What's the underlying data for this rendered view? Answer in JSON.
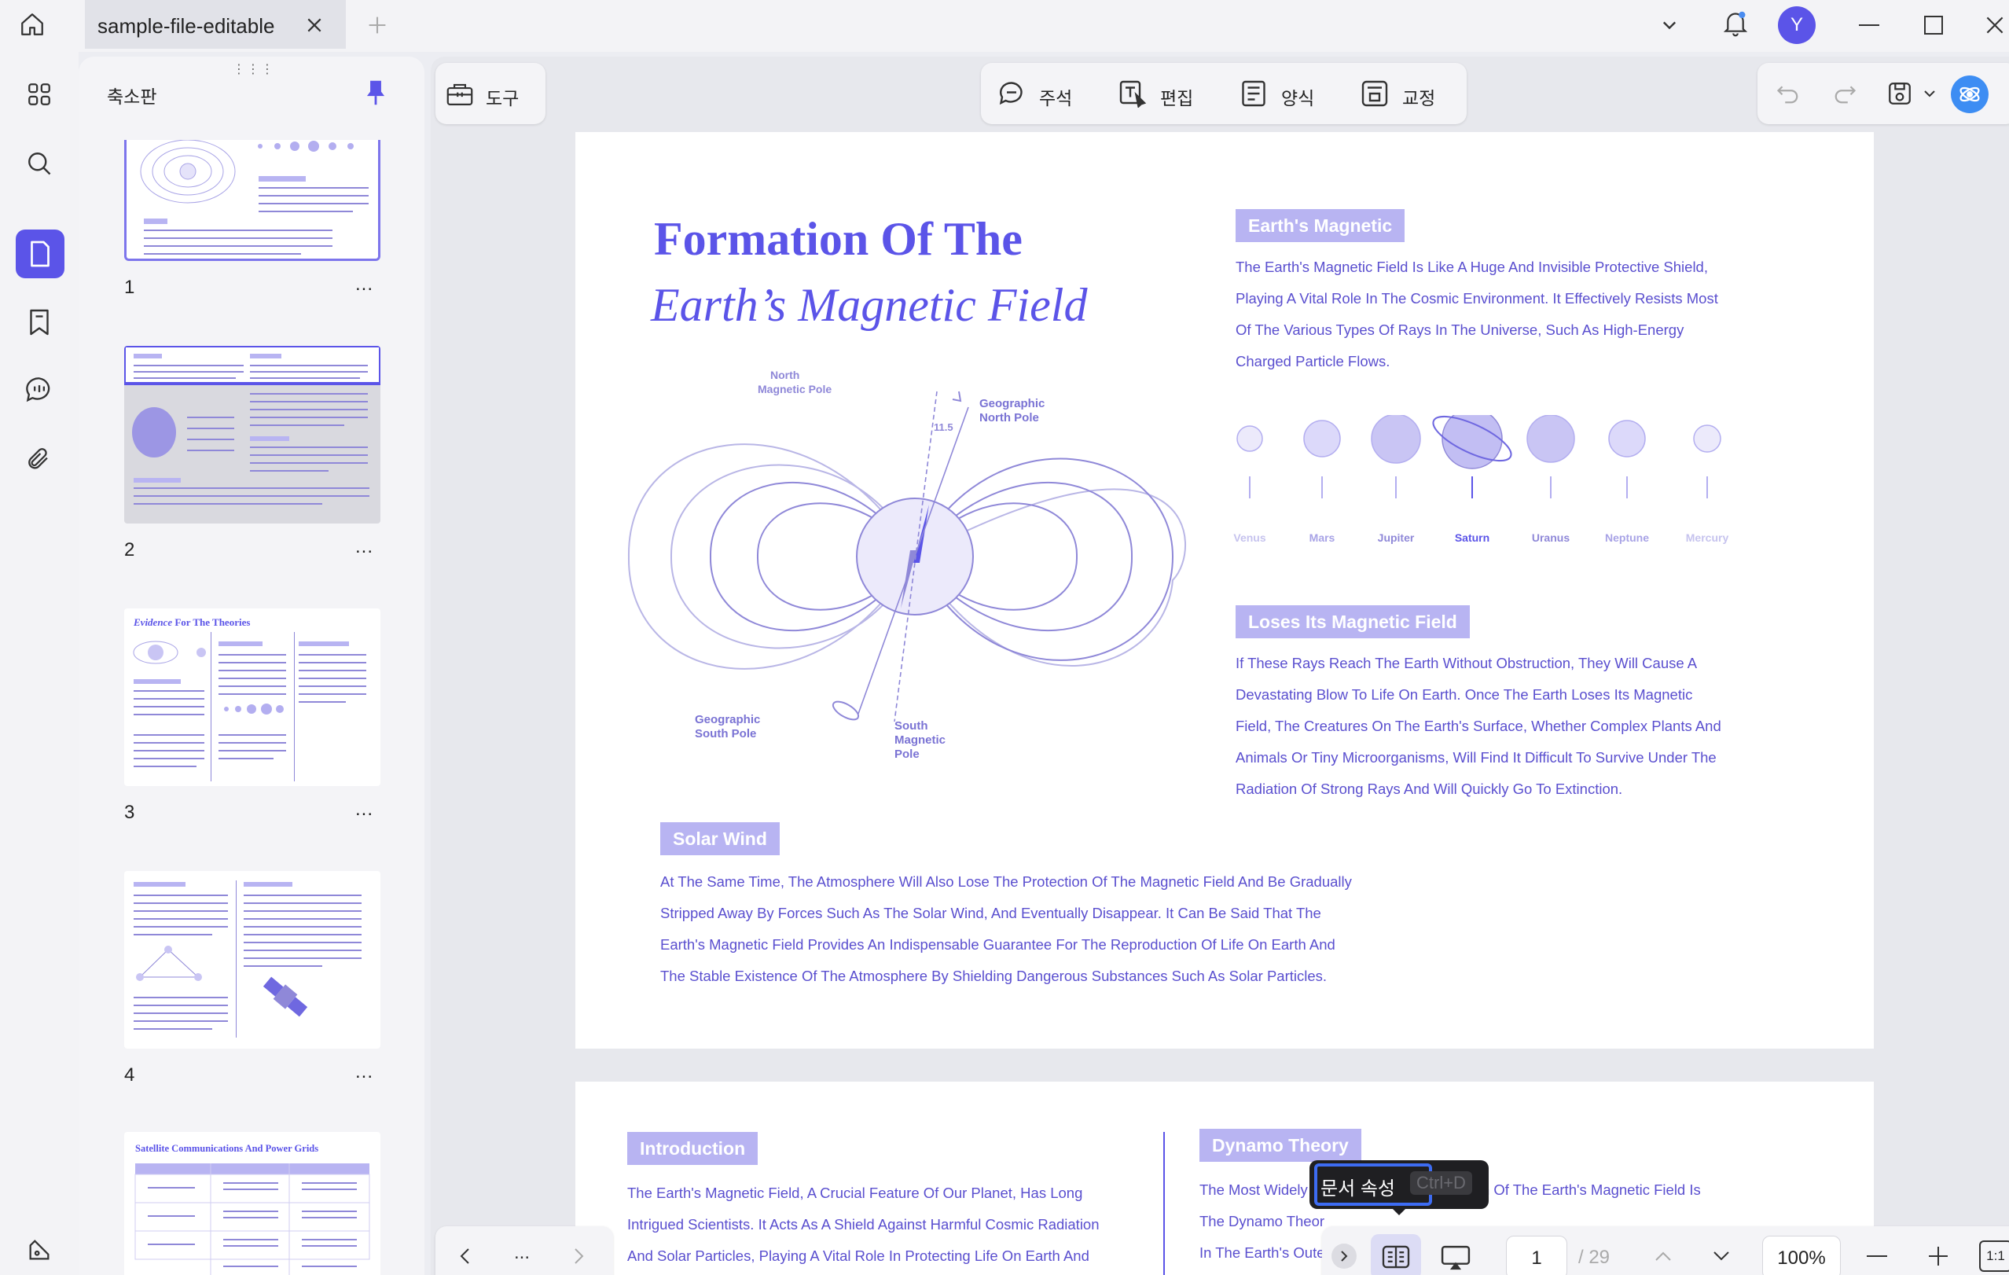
{
  "titlebar": {
    "tab_title": "sample-file-editable",
    "avatar_letter": "Y",
    "colors": {
      "accent": "#5b54e8",
      "avatar": "#5b54e8"
    }
  },
  "sidebar": {
    "panel_title": "축소판",
    "pages": [
      {
        "number": "1",
        "more": "..."
      },
      {
        "number": "2",
        "more": "..."
      },
      {
        "number": "3",
        "more": "..."
      },
      {
        "number": "4",
        "more": "..."
      }
    ],
    "thumb3_title_italic": "Evidence",
    "thumb3_title_rest": "For The Theories",
    "thumb5_title": "Satellite Communications And Power Grids"
  },
  "toolbar": {
    "tools_label": "도구",
    "annotate_label": "주석",
    "edit_label": "편집",
    "form_label": "양식",
    "proof_label": "교정"
  },
  "page1": {
    "title_line1": "Formation Of The",
    "title_line2": "Earth’s Magnetic Field",
    "diagram": {
      "north_magnetic_pole": [
        "North",
        "Magnetic Pole"
      ],
      "geographic_north_pole": [
        "Geographic",
        "North Pole"
      ],
      "angle": "11.5",
      "geographic_south_pole": [
        "Geographic",
        "South Pole"
      ],
      "south_magnetic_pole": [
        "South",
        "Magnetic",
        "Pole"
      ]
    },
    "earth_magnetic": {
      "tag": "Earth's Magnetic",
      "lines": [
        "The Earth's Magnetic Field Is Like A Huge And Invisible Protective Shield,",
        "Playing A Vital Role In The Cosmic Environment. It Effectively Resists Most",
        "Of The Various Types Of Rays In The Universe, Such As High-Energy",
        "Charged Particle Flows."
      ]
    },
    "planets": [
      "Venus",
      "Mars",
      "Jupiter",
      "Saturn",
      "Uranus",
      "Neptune",
      "Mercury"
    ],
    "loses": {
      "tag": "Loses Its Magnetic Field",
      "lines": [
        "If These Rays Reach The Earth Without Obstruction, They Will Cause A",
        "Devastating Blow To Life On Earth. Once The Earth Loses Its Magnetic",
        "Field, The Creatures On The Earth's Surface, Whether Complex Plants And",
        "Animals Or Tiny Microorganisms, Will Find It Difficult To Survive Under The",
        "Radiation Of Strong Rays And Will Quickly Go To Extinction."
      ]
    },
    "solar_wind": {
      "tag": "Solar Wind",
      "lines": [
        "At The Same Time, The Atmosphere Will Also Lose The Protection Of The Magnetic Field And Be Gradually",
        "Stripped Away By Forces Such As The Solar Wind, And Eventually Disappear. It Can Be Said That The",
        "Earth's Magnetic Field Provides An Indispensable Guarantee For The Reproduction Of Life On Earth And",
        "The Stable Existence Of The Atmosphere By Shielding Dangerous Substances Such As Solar Particles."
      ]
    }
  },
  "page2": {
    "intro_tag": "Introduction",
    "intro_lines": [
      "The Earth's Magnetic Field, A Crucial Feature Of Our Planet, Has Long",
      "Intrigued Scientists. It Acts As A Shield Against Harmful Cosmic Radiation",
      "And Solar Particles, Playing A Vital Role In Protecting Life On Earth And"
    ],
    "dynamo_tag": "Dynamo Theory",
    "dynamo_lines": [
      "The Most Widely",
      "The Dynamo Theor",
      "In The Earth's Oute"
    ],
    "dynamo_line1_tail": "Formation Of The Earth's Magnetic Field Is"
  },
  "tooltip": {
    "label": "문서 속성",
    "shortcut": "Ctrl+D"
  },
  "bottombar": {
    "more": "...",
    "page_current": "1",
    "page_total": "/ 29",
    "zoom": "100%",
    "actual_size": "1:1"
  }
}
